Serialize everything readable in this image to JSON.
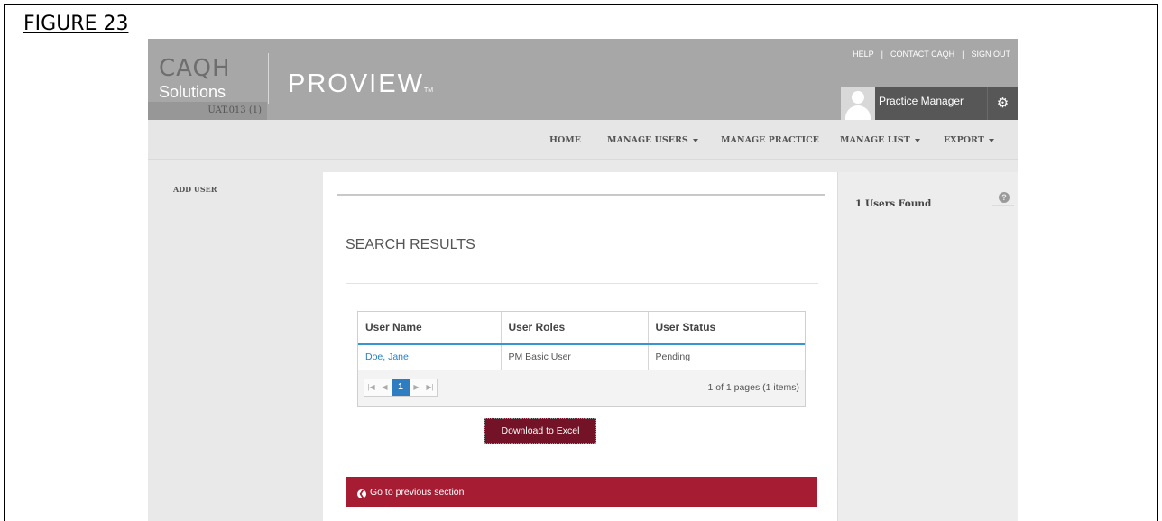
{
  "figure_label": "FIGURE 23",
  "header": {
    "logo_caqh": "CAQH",
    "logo_solutions": "Solutions",
    "logo_proview": "PROVIEW",
    "logo_tm": "TM",
    "instance": "UAT.013 (1)",
    "links": [
      "HELP",
      "CONTACT CAQH",
      "SIGN OUT"
    ],
    "user_name": "Practice Manager"
  },
  "nav": {
    "items": [
      "HOME",
      "MANAGE USERS",
      "MANAGE PRACTICE",
      "MANAGE LIST",
      "EXPORT"
    ]
  },
  "sidebar": {
    "items": [
      "ADD USER"
    ]
  },
  "main": {
    "title": "SEARCH RESULTS",
    "table": {
      "columns": [
        "User Name",
        "User Roles",
        "User Status"
      ],
      "rows": [
        [
          "Doe, Jane",
          "PM Basic User",
          "Pending"
        ]
      ]
    },
    "pager": {
      "current_page": "1",
      "info": "1 of 1 pages (1 items)"
    },
    "download_label": "Download to Excel",
    "prev_label": "Go to previous section"
  },
  "right_panel": {
    "users_found": "1 Users Found"
  },
  "colors": {
    "accent_red": "#a51c33",
    "dark_red": "#741327",
    "link_blue": "#2a7fc0",
    "grid_header_border": "#3a94d0"
  }
}
